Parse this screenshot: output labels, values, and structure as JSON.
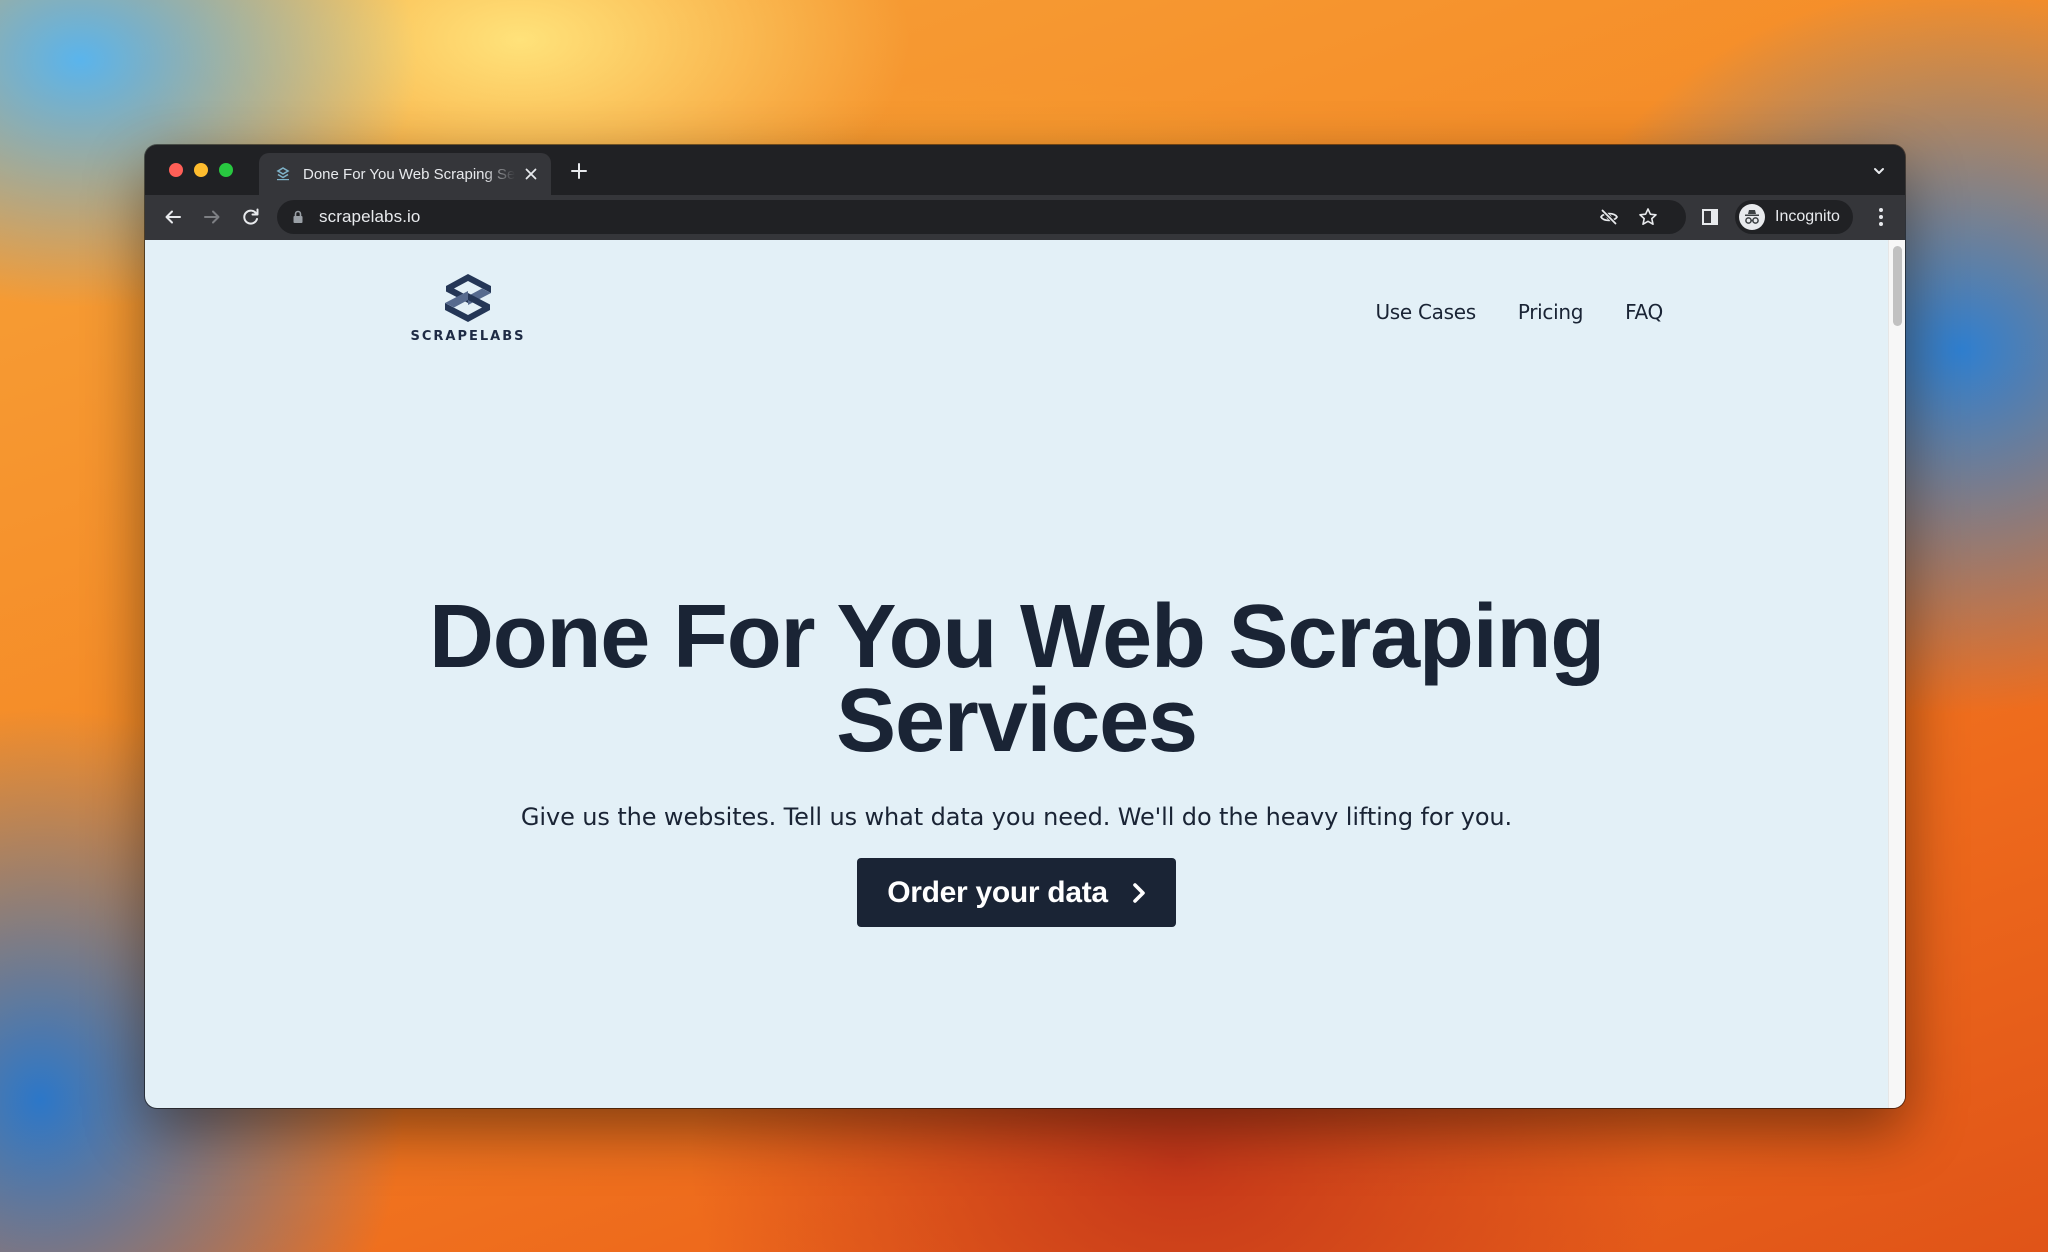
{
  "browser": {
    "tab": {
      "title": "Done For You Web Scraping Services",
      "favicon": "scrapelabs-logo-icon",
      "close_icon": "close-icon"
    },
    "new_tab_icon": "plus-icon",
    "tab_search_icon": "chevron-down-icon",
    "toolbar": {
      "back_icon": "arrow-left-icon",
      "forward_icon": "arrow-right-icon",
      "reload_icon": "reload-icon",
      "lock_icon": "lock-icon",
      "url": "scrapelabs.io",
      "tracking_icon": "eye-off-icon",
      "bookmark_icon": "star-icon",
      "side_panel_icon": "side-panel-icon",
      "profile_label": "Incognito",
      "profile_icon": "incognito-icon",
      "menu_icon": "more-vertical-icon"
    }
  },
  "page": {
    "logo": {
      "text": "SCRAPELABS"
    },
    "nav": [
      {
        "label": "Use Cases"
      },
      {
        "label": "Pricing"
      },
      {
        "label": "FAQ"
      }
    ],
    "hero": {
      "title_line1": "Done For You Web Scraping",
      "title_line2": "Services",
      "subtitle": "Give us the websites. Tell us what data you need. We'll do the heavy lifting for you.",
      "cta_label": "Order your data",
      "cta_icon": "chevron-right-icon"
    },
    "colors": {
      "primary": "#1a2435",
      "background": "#e3f0f7",
      "logo": "#1e2b45"
    }
  }
}
